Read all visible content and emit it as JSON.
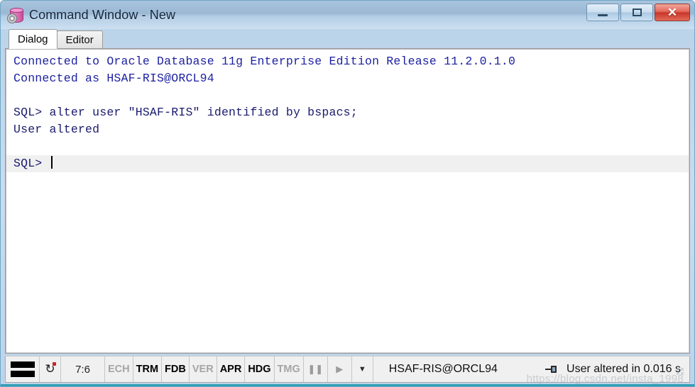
{
  "window": {
    "title": "Command Window - New",
    "icon": "database-gear-icon",
    "buttons": {
      "minimize": "—",
      "maximize": "□",
      "close": "✕"
    }
  },
  "tabs": [
    {
      "label": "Dialog",
      "active": true
    },
    {
      "label": "Editor",
      "active": false
    }
  ],
  "editor": {
    "lines": [
      {
        "text": "Connected to Oracle Database 11g Enterprise Edition Release 11.2.0.1.0",
        "highlight": false
      },
      {
        "text": "Connected as HSAF-RIS@ORCL94",
        "highlight": false
      },
      {
        "text": "",
        "highlight": false
      },
      {
        "text": "SQL> alter user \"HSAF-RIS\" identified by bspacs;",
        "highlight": false
      },
      {
        "text": "User altered",
        "highlight": false
      },
      {
        "text": "",
        "highlight": false
      },
      {
        "text": "SQL> ",
        "highlight": true,
        "caret": true
      }
    ],
    "text_color": "#1b1fa0",
    "highlight_color": "#f0f0f0"
  },
  "statusbar": {
    "lines_icon": "lines-icon",
    "refresh_icon": "refresh-icon",
    "position": "7:6",
    "flags": [
      {
        "label": "ECH",
        "on": false
      },
      {
        "label": "TRM",
        "on": true
      },
      {
        "label": "FDB",
        "on": true
      },
      {
        "label": "VER",
        "off": true,
        "on": false
      },
      {
        "label": "APR",
        "on": true
      },
      {
        "label": "HDG",
        "on": true
      },
      {
        "label": "TMG",
        "on": false
      }
    ],
    "pause_icon": "pause-icon",
    "play_icon": "play-icon",
    "dropdown_icon": "chevron-down-icon",
    "connection": "HSAF-RIS@ORCL94",
    "message_icon": "pin-icon",
    "message": "User altered in 0.016 s"
  },
  "watermark": "https://blog.csdn.net/insta_1998",
  "colors": {
    "accent": "#2e9fb5",
    "title_text": "#10253c",
    "code": "#1b1fa0",
    "close_button": "#c8362a"
  }
}
